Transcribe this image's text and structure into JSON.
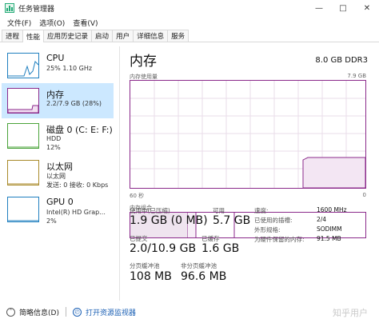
{
  "window": {
    "title": "任务管理器"
  },
  "menu": [
    "文件(F)",
    "选项(O)",
    "查看(V)"
  ],
  "tabs": [
    "进程",
    "性能",
    "应用历史记录",
    "启动",
    "用户",
    "详细信息",
    "服务"
  ],
  "active_tab": "性能",
  "sidebar": {
    "items": [
      {
        "title": "CPU",
        "sub": "25% 1.10 GHz",
        "sub2": "",
        "color": "#1f7fbf"
      },
      {
        "title": "内存",
        "sub": "2.2/7.9 GB (28%)",
        "sub2": "",
        "color": "#8b2a8b"
      },
      {
        "title": "磁盘 0 (C: E: F:)",
        "sub": "HDD",
        "sub2": "12%",
        "color": "#4aa33a"
      },
      {
        "title": "以太网",
        "sub": "以太网",
        "sub2": "发送: 0 接收: 0 Kbps",
        "color": "#a88a2a"
      },
      {
        "title": "GPU 0",
        "sub": "Intel(R) HD Grap...",
        "sub2": "2%",
        "color": "#1f7fbf"
      }
    ]
  },
  "main": {
    "title": "内存",
    "spec": "8.0 GB DDR3",
    "usage_label": "内存使用量",
    "usage_max": "7.9 GB",
    "time_left": "60 秒",
    "time_right": "0",
    "composition_label": "内存组合",
    "usage_fraction": 0.28,
    "stats": {
      "in_use_label": "使用中(已压缩)",
      "in_use_value": "1.9 GB (0 MB)",
      "available_label": "可用",
      "available_value": "5.7 GB",
      "committed_label": "已提交",
      "committed_value": "2.0/10.9 GB",
      "cached_label": "已缓存",
      "cached_value": "1.6 GB",
      "paged_label": "分页缓冲池",
      "paged_value": "108 MB",
      "nonpaged_label": "非分页缓冲池",
      "nonpaged_value": "96.6 MB"
    },
    "details": [
      {
        "key": "速度:",
        "value": "1600 MHz"
      },
      {
        "key": "已使用的插槽:",
        "value": "2/4"
      },
      {
        "key": "外形规格:",
        "value": "SODIMM"
      },
      {
        "key": "为硬件保留的内存:",
        "value": "91.5 MB"
      }
    ]
  },
  "footer": {
    "brief_label": "简略信息(D)",
    "monitor_label": "打开资源监视器",
    "watermark": "知乎用户"
  }
}
